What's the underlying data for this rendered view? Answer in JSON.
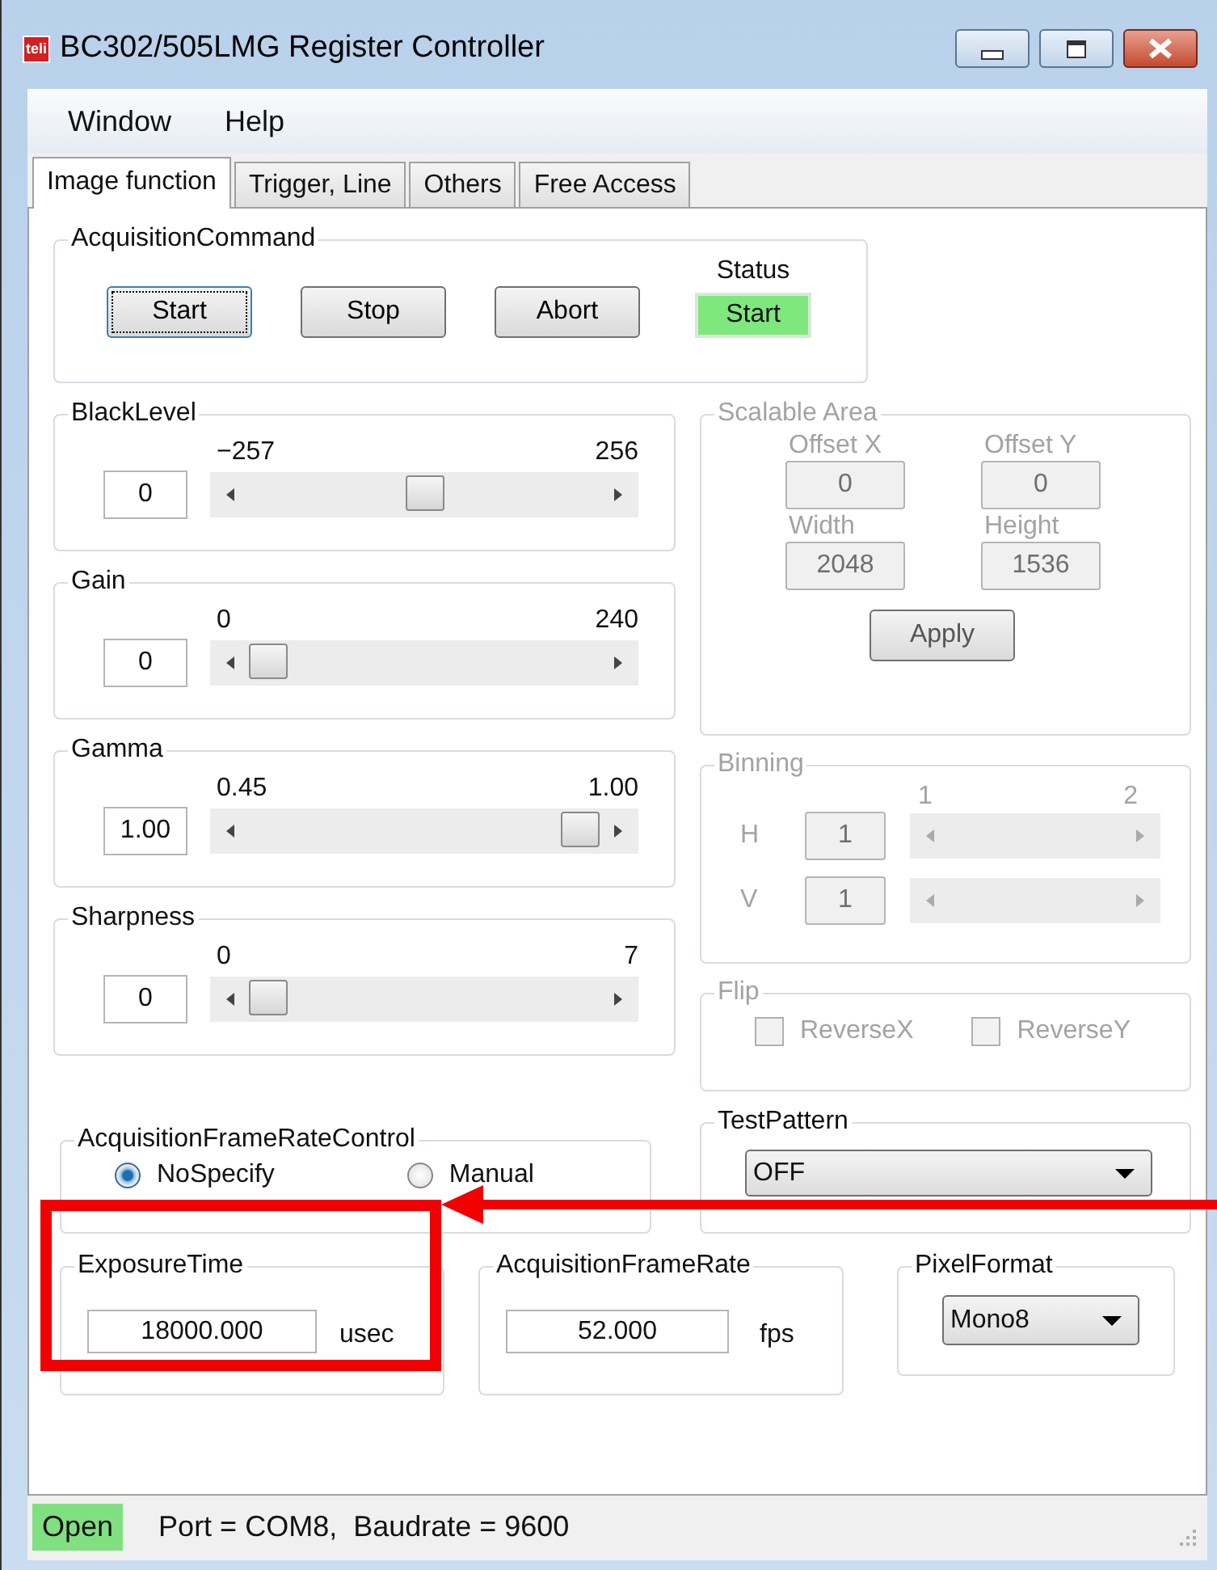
{
  "window": {
    "icon_text": "teli",
    "title": "BC302/505LMG Register Controller"
  },
  "menu": [
    "Window",
    "Help"
  ],
  "tabs": [
    {
      "label": "Image function",
      "selected": true
    },
    {
      "label": "Trigger, Line",
      "selected": false
    },
    {
      "label": "Others",
      "selected": false
    },
    {
      "label": "Free Access",
      "selected": false
    }
  ],
  "acquisition_command": {
    "title": "AcquisitionCommand",
    "buttons": [
      {
        "label": "Start",
        "focused": true
      },
      {
        "label": "Stop",
        "focused": false
      },
      {
        "label": "Abort",
        "focused": false
      }
    ],
    "status_label": "Status",
    "status_value": "Start"
  },
  "sliders": [
    {
      "title": "BlackLevel",
      "min_label": "−257",
      "max_label": "256",
      "value": "0",
      "level": 0.5
    },
    {
      "title": "Gain",
      "min_label": "0",
      "max_label": "240",
      "value": "0",
      "level": 0
    },
    {
      "title": "Gamma",
      "min_label": "0.45",
      "max_label": "1.00",
      "value": "1.00",
      "level": 1
    },
    {
      "title": "Sharpness",
      "min_label": "0",
      "max_label": "7",
      "value": "0",
      "level": 0
    }
  ],
  "scalable_area": {
    "title": "Scalable Area",
    "disabled": true,
    "fields": [
      {
        "label": "Offset X",
        "value": "0"
      },
      {
        "label": "Offset Y",
        "value": "0"
      },
      {
        "label": "Width",
        "value": "2048"
      },
      {
        "label": "Height",
        "value": "1536"
      }
    ],
    "apply_button": "Apply"
  },
  "binning": {
    "title": "Binning",
    "disabled": true,
    "min_label": "1",
    "max_label": "2",
    "rows": [
      {
        "label": "H",
        "value": "1"
      },
      {
        "label": "V",
        "value": "1"
      }
    ]
  },
  "flip": {
    "title": "Flip",
    "disabled": true,
    "checkboxes": [
      {
        "label": "ReverseX",
        "checked": false
      },
      {
        "label": "ReverseY",
        "checked": false
      }
    ]
  },
  "frame_rate_control": {
    "title": "AcquisitionFrameRateControl",
    "options": [
      {
        "label": "NoSpecify",
        "selected": true
      },
      {
        "label": "Manual",
        "selected": false
      }
    ]
  },
  "test_pattern": {
    "title": "TestPattern",
    "value": "OFF"
  },
  "exposure_time": {
    "title": "ExposureTime",
    "value": "18000.000",
    "unit": "usec"
  },
  "frame_rate": {
    "title": "AcquisitionFrameRate",
    "value": "52.000",
    "unit": "fps"
  },
  "pixel_format": {
    "title": "PixelFormat",
    "value": "Mono8"
  },
  "status_bar": {
    "state": "Open",
    "text": "Port = COM8,  Baudrate = 9600"
  }
}
